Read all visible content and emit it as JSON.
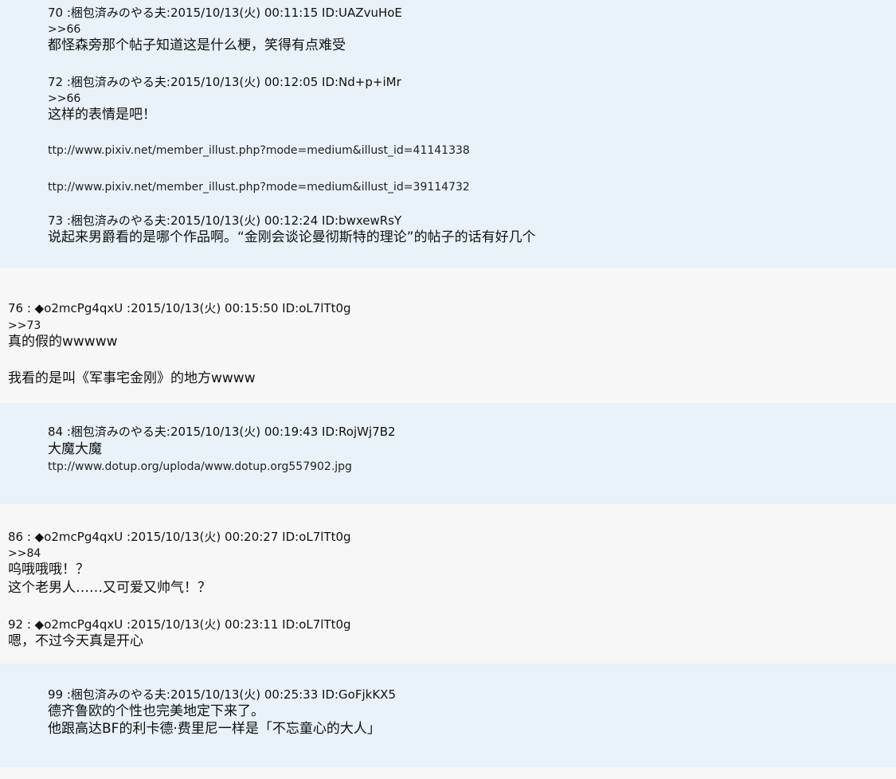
{
  "posts": [
    {
      "header": "70 :梱包済みのやる夫:2015/10/13(火) 00:11:15 ID:UAZvuHoE",
      "lines": [
        ">>66",
        "都怪森旁那个帖子知道这是什么梗，笑得有点难受"
      ]
    },
    {
      "header": "72 :梱包済みのやる夫:2015/10/13(火) 00:12:05 ID:Nd+p+iMr",
      "lines": [
        ">>66",
        "这样的表情是吧！",
        "ttp://www.pixiv.net/member_illust.php?mode=medium&illust_id=41141338",
        "ttp://www.pixiv.net/member_illust.php?mode=medium&illust_id=39114732"
      ]
    },
    {
      "header": "73 :梱包済みのやる夫:2015/10/13(火) 00:12:24 ID:bwxewRsY",
      "lines": [
        "说起来男爵看的是哪个作品啊。“金刚会谈论曼彻斯特的理论”的帖子的话有好几个"
      ]
    },
    {
      "header": "76 : ◆o2mcPg4qxU :2015/10/13(火) 00:15:50 ID:oL7lTt0g",
      "lines": [
        ">>73",
        "真的假的wwwww",
        "我看的是叫《军事宅金刚》的地方wwww"
      ]
    },
    {
      "header": "84 :梱包済みのやる夫:2015/10/13(火) 00:19:43 ID:RojWj7B2",
      "lines": [
        "大魔大魔",
        "ttp://www.dotup.org/uploda/www.dotup.org557902.jpg"
      ]
    },
    {
      "header": "86 : ◆o2mcPg4qxU :2015/10/13(火) 00:20:27 ID:oL7lTt0g",
      "lines": [
        ">>84",
        "呜哦哦哦！？",
        "这个老男人……又可爱又帅气！？"
      ]
    },
    {
      "header": "92 : ◆o2mcPg4qxU :2015/10/13(火) 00:23:11 ID:oL7lTt0g",
      "lines": [
        "嗯，不过今天真是开心"
      ]
    },
    {
      "header": "99 :梱包済みのやる夫:2015/10/13(火) 00:25:33 ID:GoFjkKX5",
      "lines": [
        "德齐鲁欧的个性也完美地定下来了。",
        "他跟高达BF的利卡德·费里尼一样是「不忘童心的大人」"
      ]
    }
  ]
}
